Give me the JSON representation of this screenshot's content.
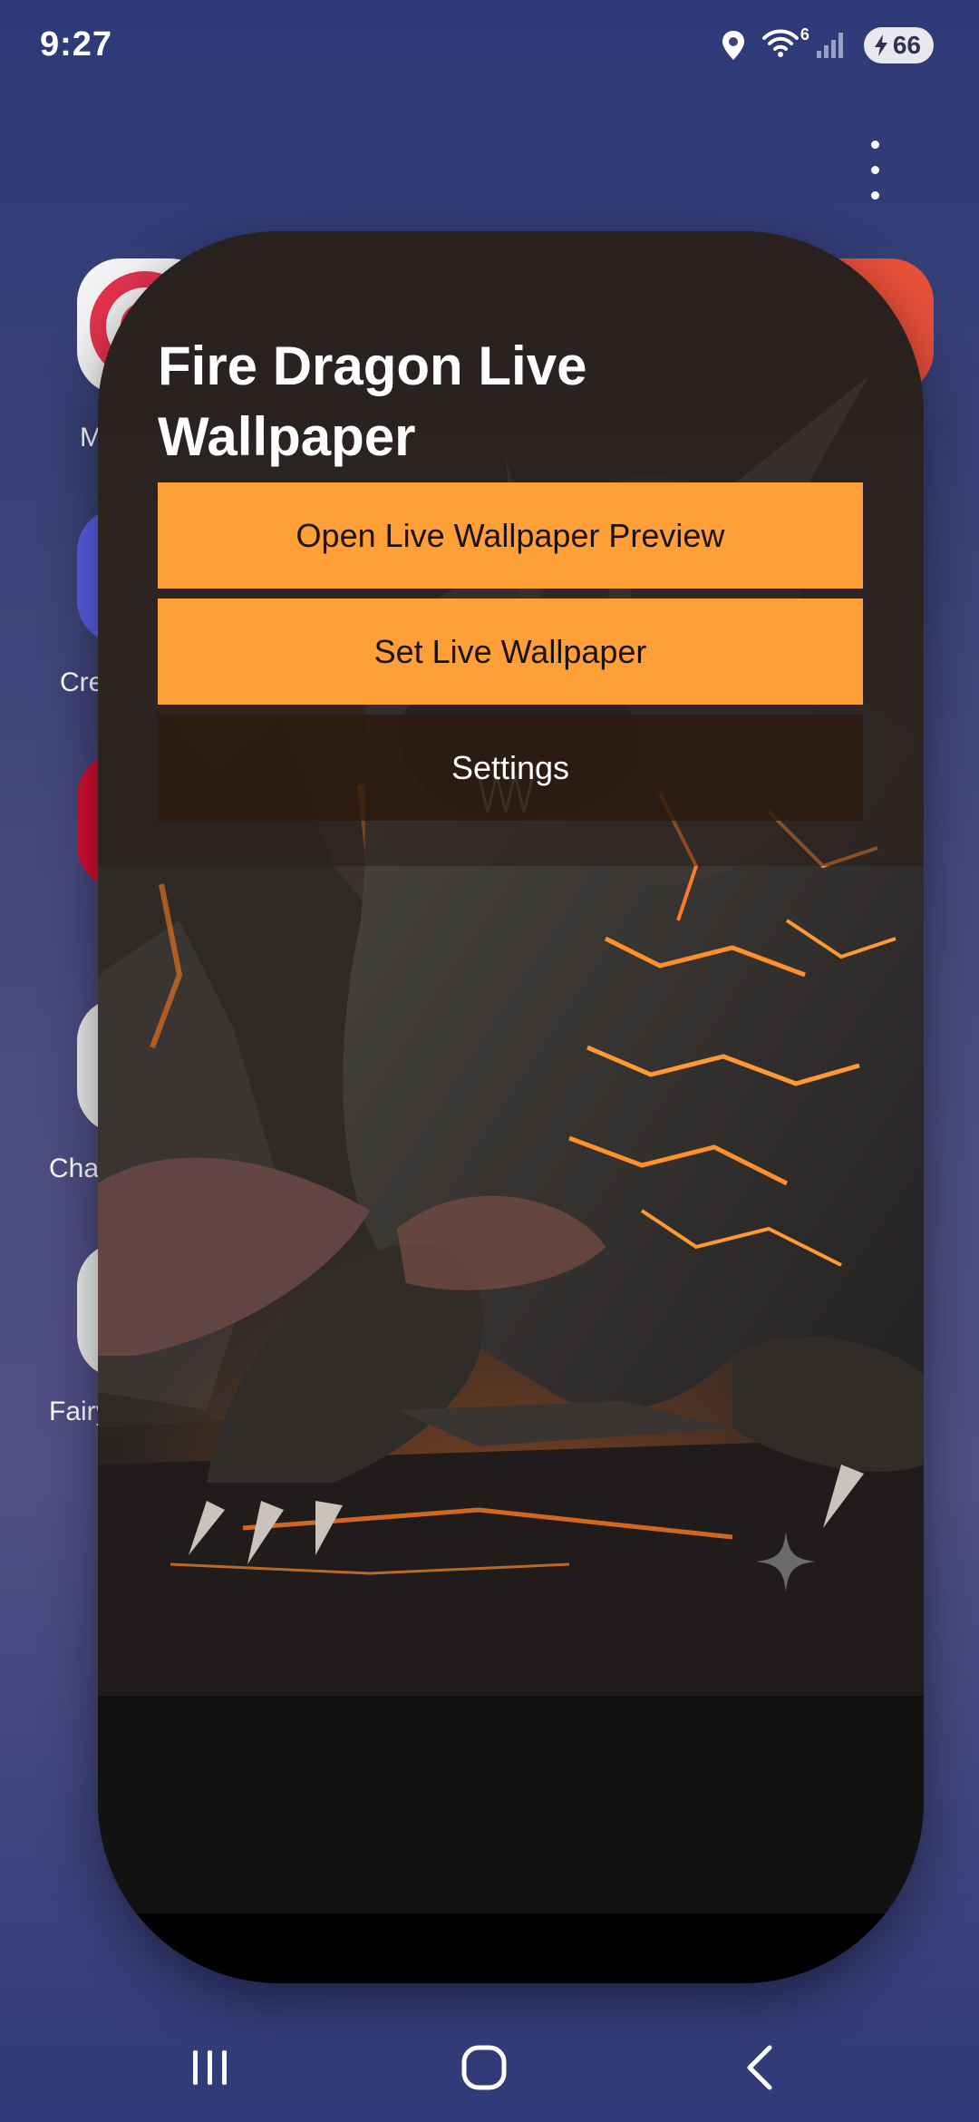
{
  "status_bar": {
    "time": "9:27",
    "wifi_badge": "6",
    "battery_level": "66"
  },
  "background_apps": {
    "labels": [
      "M",
      "Cre",
      "Chac",
      "Fairy"
    ]
  },
  "wallpaper_card": {
    "title": "Fire Dragon Live Wallpaper",
    "preview_button": "Open Live Wallpaper Preview",
    "set_button": "Set Live Wallpaper",
    "settings_button": "Settings"
  },
  "colors": {
    "accent_orange": "#ff9f38",
    "settings_bg": "#2d1a0e",
    "card_bg": "#121212"
  },
  "icons": {
    "status": [
      "location-icon",
      "wifi-icon",
      "signal-icon",
      "battery-charging-icon"
    ],
    "nav": [
      "recents-icon",
      "home-icon",
      "back-icon"
    ],
    "menu": "more-vert-icon",
    "overlay": "sparkle-icon"
  }
}
